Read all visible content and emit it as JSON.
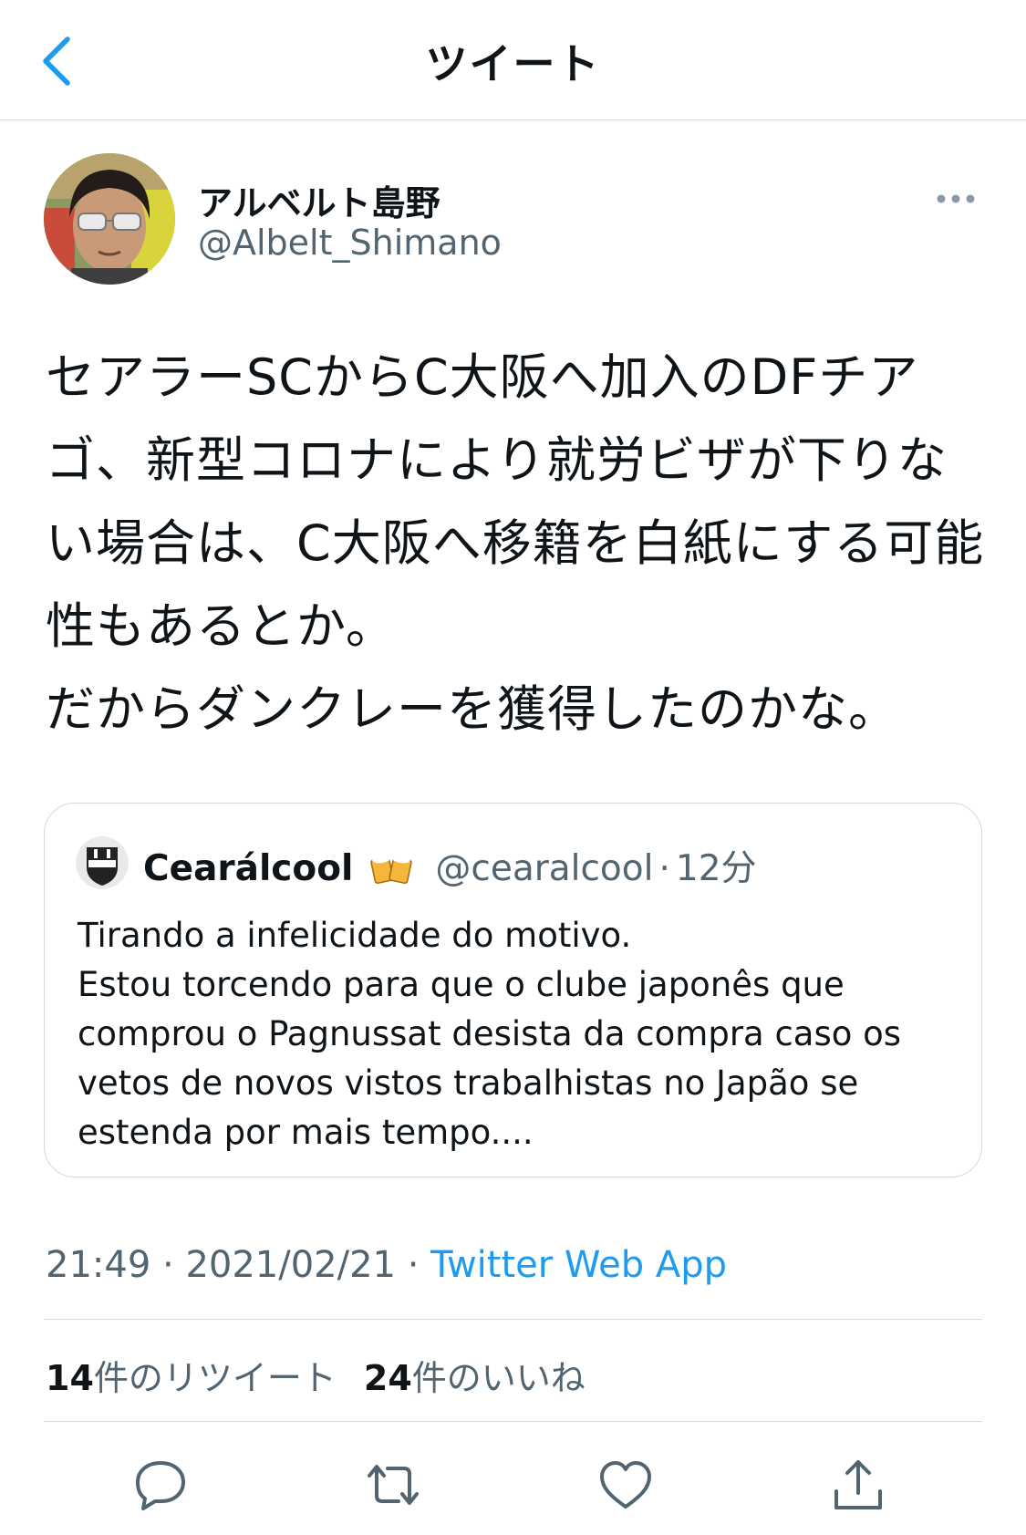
{
  "header": {
    "title": "ツイート",
    "back_icon": "chevron-left-icon"
  },
  "author": {
    "name": "アルベルト島野",
    "handle": "@Albelt_Shimano"
  },
  "tweet": {
    "text": "セアラーSCからC大阪へ加入のDFチアゴ、新型コロナにより就労ビザが下りない場合は、C大阪へ移籍を白紙にする可能性もあるとか。\nだからダンクレーを獲得したのかな。"
  },
  "quote": {
    "name": "Cearálcool",
    "emoji": "beer-mugs-icon",
    "handle": "@cearalcool",
    "dot": "·",
    "time": "12分",
    "text": "Tirando a infelicidade do motivo.\nEstou torcendo para que o clube japonês que comprou o Pagnussat desista da compra caso os vetos de novos vistos trabalhistas no Japão se estenda por mais tempo...."
  },
  "meta": {
    "time": "21:49",
    "sep1": " · ",
    "date": "2021/02/21",
    "sep2": " · ",
    "source": "Twitter Web App"
  },
  "stats": {
    "retweets_count": "14",
    "retweets_label": "件のリツイート",
    "likes_count": "24",
    "likes_label": "件のいいね"
  },
  "actions": [
    "reply-icon",
    "retweet-icon",
    "like-icon",
    "share-icon"
  ],
  "colors": {
    "accent": "#1d9bf0",
    "text": "#0f1419",
    "secondary": "#536471",
    "border": "#cfd9de"
  }
}
